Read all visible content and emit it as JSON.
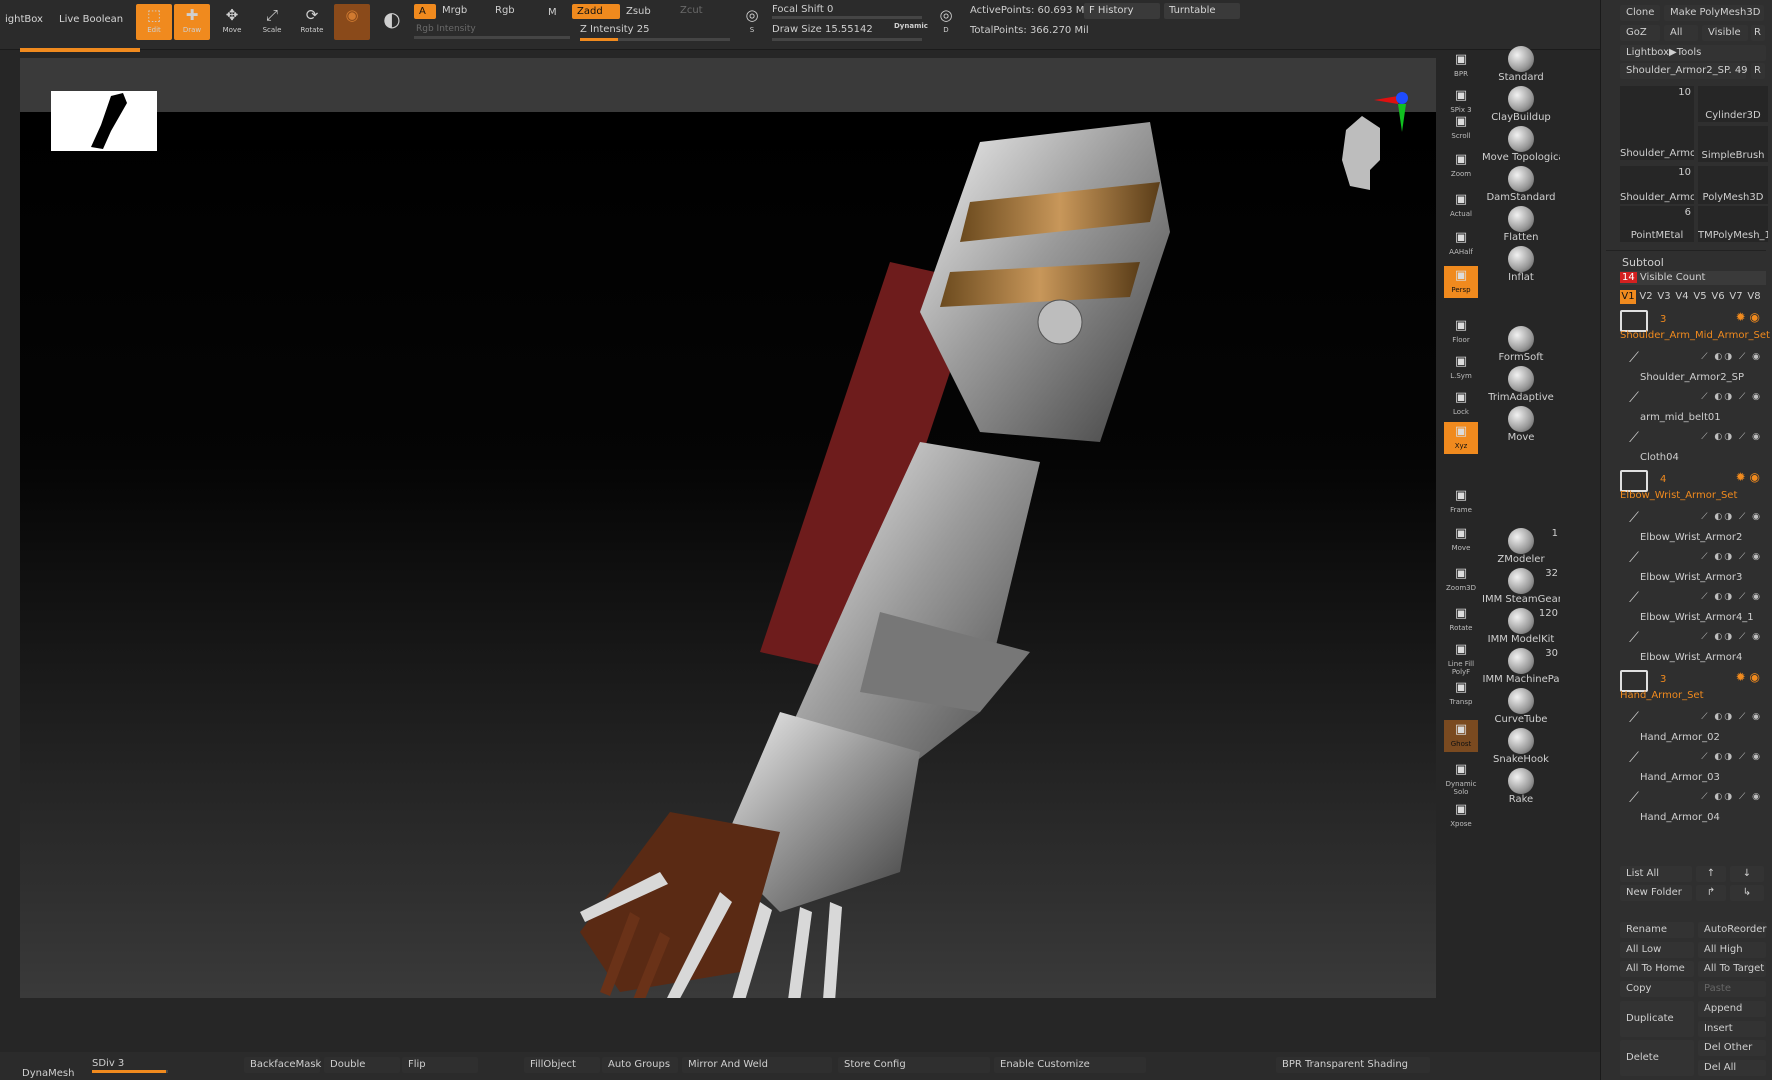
{
  "top": {
    "lightbox": "ightBox",
    "live_boolean": "Live Boolean",
    "tools": [
      {
        "label": "Edit",
        "icon": "edit-icon",
        "active": true
      },
      {
        "label": "Draw",
        "icon": "draw-icon",
        "active": true
      },
      {
        "label": "Move",
        "icon": "move-icon",
        "active": false
      },
      {
        "label": "Scale",
        "icon": "scale-icon",
        "active": false
      },
      {
        "label": "Rotate",
        "icon": "rotate-icon",
        "active": false
      }
    ],
    "a_label": "A",
    "mrgb": "Mrgb",
    "rgb": "Rgb",
    "m": "M",
    "rgb_intensity": "Rgb Intensity",
    "zadd": "Zadd",
    "zsub": "Zsub",
    "zcut": "Zcut",
    "z_intensity": "Z Intensity 25",
    "z_intensity_value": 25,
    "focal_shift": "Focal Shift 0",
    "draw_size": "Draw Size 15.55142",
    "dynamic": "Dynamic",
    "active_points": "ActivePoints: 60.693 Mil",
    "total_points": "TotalPoints: 366.270 Mil",
    "f_history": "F History",
    "turntable": "Turntable",
    "s_label": "S",
    "d_label": "D"
  },
  "vertical_toolbar": [
    {
      "label": "BPR",
      "icon": "bpr-icon"
    },
    {
      "label": "SPix 3",
      "icon": "spix-slider"
    },
    {
      "label": "Scroll",
      "icon": "scroll-icon"
    },
    {
      "label": "Zoom",
      "icon": "zoom-icon"
    },
    {
      "label": "Actual",
      "icon": "actual-icon"
    },
    {
      "label": "AAHalf",
      "icon": "aahalf-icon"
    },
    {
      "label": "Persp",
      "icon": "persp-icon"
    },
    {
      "label": "Floor",
      "icon": "floor-icon"
    },
    {
      "label": "L.Sym",
      "icon": "lsym-icon"
    },
    {
      "label": "Lock",
      "icon": "lock-icon"
    },
    {
      "label": "Xyz",
      "icon": "xyz-icon"
    },
    {
      "label": "Frame",
      "icon": "frame-icon"
    },
    {
      "label": "Move",
      "icon": "move3d-icon"
    },
    {
      "label": "Zoom3D",
      "icon": "zoom3d-icon"
    },
    {
      "label": "Rotate",
      "icon": "rotate3d-icon"
    },
    {
      "label": "Line Fill PolyF",
      "icon": "polyf-icon"
    },
    {
      "label": "Transp",
      "icon": "transp-icon"
    },
    {
      "label": "Ghost",
      "icon": "ghost-icon"
    },
    {
      "label": "Dynamic Solo",
      "icon": "solo-icon"
    },
    {
      "label": "Xpose",
      "icon": "xpose-icon"
    }
  ],
  "brushes": [
    {
      "label": "Standard",
      "count": ""
    },
    {
      "label": "ClayBuildup",
      "count": ""
    },
    {
      "label": "Move Topologica",
      "count": ""
    },
    {
      "label": "DamStandard",
      "count": ""
    },
    {
      "label": "Flatten",
      "count": ""
    },
    {
      "label": "Inflat",
      "count": ""
    },
    {
      "label": "FormSoft",
      "count": ""
    },
    {
      "label": "TrimAdaptive",
      "count": ""
    },
    {
      "label": "Move",
      "count": ""
    },
    {
      "label": "ZModeler",
      "count": "1"
    },
    {
      "label": "IMM SteamGear",
      "count": "32"
    },
    {
      "label": "IMM ModelKit",
      "count": "120"
    },
    {
      "label": "IMM MachinePa",
      "count": "30"
    },
    {
      "label": "CurveTube",
      "count": ""
    },
    {
      "label": "SnakeHook",
      "count": ""
    },
    {
      "label": "Rake",
      "count": ""
    }
  ],
  "right_panel": {
    "clone": "Clone",
    "make_polymesh": "Make PolyMesh3D",
    "goz": "GoZ",
    "all": "All",
    "visible": "Visible",
    "r": "R",
    "lightbox_tools": "Lightbox▶Tools",
    "current_tool": "Shoulder_Armor2_SP. 49",
    "tool_thumbs": [
      {
        "label": "Shoulder_Armor",
        "count": "10"
      },
      {
        "label": "Cylinder3D",
        "count": ""
      },
      {
        "label": "SimpleBrush",
        "count": ""
      },
      {
        "label": "Shoulder_Armor",
        "count": "10"
      },
      {
        "label": "PolyMesh3D",
        "count": ""
      },
      {
        "label": "PointMEtal",
        "count": "6"
      },
      {
        "label": "TMPolyMesh_1",
        "count": ""
      }
    ],
    "subtool_title": "Subtool",
    "visible_count_num": "14",
    "visible_count_label": "Visible Count",
    "versions": [
      "V1",
      "V2",
      "V3",
      "V4",
      "V5",
      "V6",
      "V7",
      "V8"
    ],
    "folders": [
      {
        "count": "3",
        "name": "Shoulder_Arm_Mid_Armor_Set",
        "items": [
          "Shoulder_Armor2_SP",
          "arm_mid_belt01",
          "Cloth04"
        ]
      },
      {
        "count": "4",
        "name": "Elbow_Wrist_Armor_Set",
        "items": [
          "Elbow_Wrist_Armor2",
          "Elbow_Wrist_Armor3",
          "Elbow_Wrist_Armor4_1",
          "Elbow_Wrist_Armor4"
        ]
      },
      {
        "count": "3",
        "name": "Hand_Armor_Set",
        "items": [
          "Hand_Armor_02",
          "Hand_Armor_03",
          "Hand_Armor_04"
        ]
      }
    ],
    "list_all": "List All",
    "new_folder": "New Folder",
    "rename": "Rename",
    "auto_reorder": "AutoReorder",
    "all_low": "All Low",
    "all_high": "All High",
    "all_to_home": "All To Home",
    "all_to_target": "All To Target",
    "copy": "Copy",
    "paste": "Paste",
    "duplicate": "Duplicate",
    "append": "Append",
    "insert": "Insert",
    "delete": "Delete",
    "del_other": "Del Other",
    "del_all": "Del All"
  },
  "bottom": {
    "dynamesh": "DynaMesh",
    "sdiv": "SDiv 3",
    "backface_mask": "BackfaceMask",
    "double": "Double",
    "flip": "Flip",
    "fill_object": "FillObject",
    "auto_groups": "Auto Groups",
    "mirror_and_weld": "Mirror And Weld",
    "store_config": "Store Config",
    "enable_customize": "Enable Customize",
    "bpr_transparent_shading": "BPR Transparent Shading"
  },
  "colors": {
    "accent": "#f08a1e",
    "panel": "#2f2f2f",
    "canvas": "#000000"
  }
}
